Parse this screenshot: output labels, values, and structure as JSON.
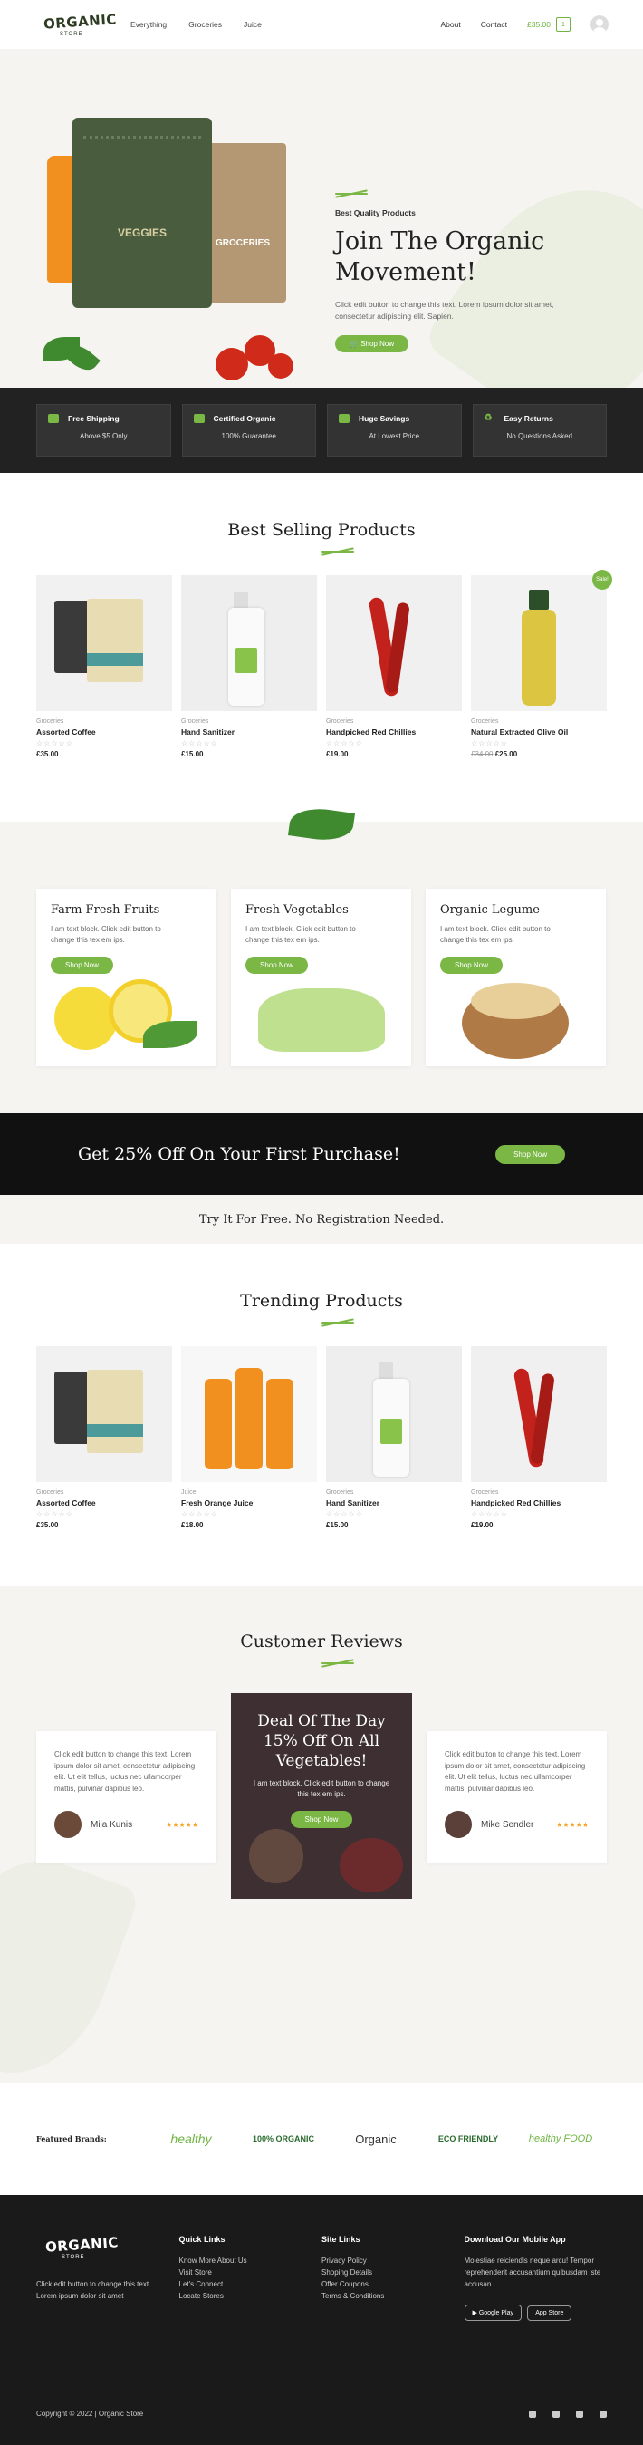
{
  "header": {
    "logo": "ORGANIC",
    "logo_sub": "STORE",
    "nav": [
      "Everything",
      "Groceries",
      "Juice"
    ],
    "right_nav": [
      "About",
      "Contact"
    ],
    "cart_total": "£35.00",
    "cart_count": "1"
  },
  "hero": {
    "bag_label": "VEGGIES",
    "bag2_label": "GROCERIES",
    "subtitle": "Best Quality Products",
    "title": "Join The Organic Movement!",
    "description": "Click edit button to change this text. Lorem ipsum dolor sit amet, consectetur adipiscing elit. Sapien.",
    "button": "Shop Now"
  },
  "features": [
    {
      "title": "Free Shipping",
      "sub": "Above $5 Only",
      "icon": "truck-icon"
    },
    {
      "title": "Certified Organic",
      "sub": "100% Guarantee",
      "icon": "certificate-icon"
    },
    {
      "title": "Huge Savings",
      "sub": "At Lowest Price",
      "icon": "money-icon"
    },
    {
      "title": "Easy Returns",
      "sub": "No Questions Asked",
      "icon": "recycle-icon"
    }
  ],
  "best_selling": {
    "title": "Best Selling Products",
    "products": [
      {
        "category": "Groceries",
        "name": "Assorted Coffee",
        "price": "£35.00",
        "old_price": ""
      },
      {
        "category": "Groceries",
        "name": "Hand Sanitizer",
        "price": "£15.00",
        "old_price": ""
      },
      {
        "category": "Groceries",
        "name": "Handpicked Red Chillies",
        "price": "£19.00",
        "old_price": ""
      },
      {
        "category": "Groceries",
        "name": "Natural Extracted Olive Oil",
        "price": "£25.00",
        "old_price": "£34.00",
        "badge": "Sale!"
      }
    ]
  },
  "categories": [
    {
      "title": "Farm Fresh Fruits",
      "desc": "I am text block. Click edit button to change this tex em ips.",
      "button": "Shop Now"
    },
    {
      "title": "Fresh Vegetables",
      "desc": "I am text block. Click edit button to change this tex em ips.",
      "button": "Shop Now"
    },
    {
      "title": "Organic Legume",
      "desc": "I am text block. Click edit button to change this tex em ips.",
      "button": "Shop Now"
    }
  ],
  "promo": {
    "title": "Get 25% Off On Your First Purchase!",
    "button": "Shop Now",
    "try_text": "Try It For Free. No Registration Needed."
  },
  "trending": {
    "title": "Trending Products",
    "products": [
      {
        "category": "Groceries",
        "name": "Assorted Coffee",
        "price": "£35.00"
      },
      {
        "category": "Juice",
        "name": "Fresh Orange Juice",
        "price": "£18.00"
      },
      {
        "category": "Groceries",
        "name": "Hand Sanitizer",
        "price": "£15.00"
      },
      {
        "category": "Groceries",
        "name": "Handpicked Red Chillies",
        "price": "£19.00"
      }
    ]
  },
  "reviews": {
    "title": "Customer Reviews",
    "items": [
      {
        "text": "Click edit button to change this text. Lorem ipsum dolor sit amet, consectetur adipiscing elit. Ut elit tellus, luctus nec ullamcorper mattis, pulvinar dapibus leo.",
        "name": "Mila Kunis"
      },
      {
        "text": "Click edit button to change this text. Lorem ipsum dolor sit amet, consectetur adipiscing elit. Ut elit tellus, luctus nec ullamcorper mattis, pulvinar dapibus leo.",
        "name": "Mike Sendler"
      }
    ],
    "deal": {
      "title": "Deal Of The Day 15% Off On All Vegetables!",
      "desc": "I am text block. Click edit button to change this tex em ips.",
      "button": "Shop Now"
    }
  },
  "brands": {
    "label": "Featured Brands:",
    "items": [
      "healthy",
      "100% ORGANIC",
      "Organic",
      "ECO FRIENDLY",
      "healthy FOOD"
    ]
  },
  "footer": {
    "about": "Click edit button to change this text. Lorem ipsum dolor sit amet",
    "quick_links_title": "Quick Links",
    "quick_links": [
      "Know More About Us",
      "Visit Store",
      "Let's Connect",
      "Locate Stores"
    ],
    "site_links_title": "Site Links",
    "site_links": [
      "Privacy Policy",
      "Shoping Details",
      "Offer Coupons",
      "Terms & Conditions"
    ],
    "app_title": "Download Our Mobile App",
    "app_desc": "Molestiae reiciendis neque arcu! Tempor reprehenderit accusantium quibusdam iste accusan.",
    "google_play": "Google Play",
    "app_store": "App Store",
    "copyright": "Copyright © 2022 | Organic Store"
  }
}
